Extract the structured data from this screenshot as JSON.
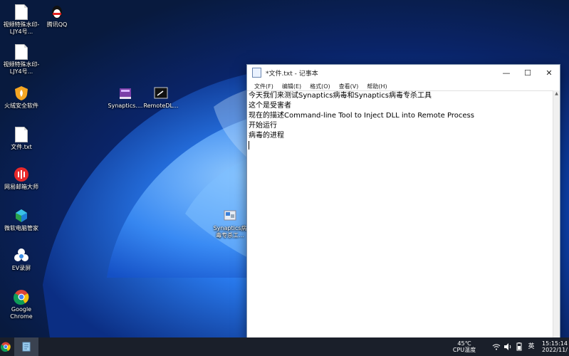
{
  "desktop": {
    "icons": [
      {
        "label": "视频特殊水印-LJY4号..."
      },
      {
        "label": "腾讯QQ"
      },
      {
        "label": "视频特殊水印-LJY4号..."
      },
      {
        "label": "火绒安全软件"
      },
      {
        "label": "文件.txt"
      },
      {
        "label": "网易邮箱大师"
      },
      {
        "label": "微软电脑管家"
      },
      {
        "label": "EV录屏"
      },
      {
        "label": "Google Chrome"
      },
      {
        "label": "Synaptics...."
      },
      {
        "label": "RemoteDL..."
      },
      {
        "label": "Synaptics病毒专杀工..."
      }
    ]
  },
  "notepad": {
    "title": "*文件.txt - 记事本",
    "controls": {
      "minimize": "—",
      "maximize": "☐",
      "close": "✕"
    },
    "menu": [
      "文件(F)",
      "编辑(E)",
      "格式(O)",
      "查看(V)",
      "帮助(H)"
    ],
    "lines": [
      "今天我们来测试Synaptics病毒和Synaptics病毒专杀工具",
      "这个是受害者",
      "现在的描述Command-line Tool to Inject DLL into Remote Process",
      "开始运行",
      "病毒的进程"
    ]
  },
  "taskbar": {
    "weather_temp": "45℃",
    "weather_label": "CPU温度",
    "ime": "英",
    "time": "15:15:14",
    "date": "2022/11/"
  },
  "colors": {
    "taskbar_bg": "#1a1f2a",
    "accent": "#1d6ff0"
  }
}
